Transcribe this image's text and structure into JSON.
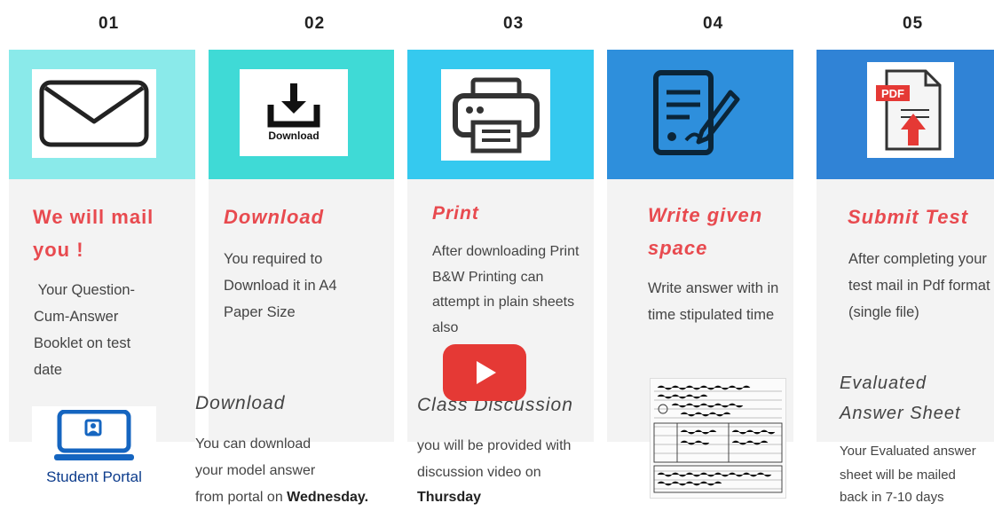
{
  "steps": [
    {
      "number": "01",
      "title": "We will mail you !",
      "body": " Your Question-Cum-Answer Booklet on test date",
      "icon": "envelope-icon"
    },
    {
      "number": "02",
      "title": "Download",
      "body": "You required to Download it in A4 Paper Size",
      "icon": "download-icon",
      "icon_label": "Download"
    },
    {
      "number": "03",
      "title": "Print",
      "body": "After downloading Print B&W Printing can attempt in plain sheets also",
      "icon": "printer-icon"
    },
    {
      "number": "04",
      "title": "Write given space",
      "body": "Write answer with in time stipulated time",
      "icon": "document-pen-icon"
    },
    {
      "number": "05",
      "title": "Submit Test",
      "body": "After completing your test mail in Pdf format (single file)",
      "icon": "pdf-upload-icon",
      "icon_label": "PDF"
    }
  ],
  "student_portal": {
    "label": "Student Portal",
    "icon": "student-portal-icon"
  },
  "download_section": {
    "title": "Download",
    "line1": "You can download",
    "line2": "your model answer",
    "line3_prefix": "from portal on ",
    "line3_bold": "Wednesday."
  },
  "class_discussion": {
    "title": "Class Discussion",
    "line1": "you will be provided with",
    "line2": "discussion video on",
    "line3_bold": "Thursday",
    "play_icon": "youtube-play-icon"
  },
  "evaluated": {
    "title_line1": "Evaluated",
    "title_line2": "Answer Sheet",
    "line1": "Your Evaluated answer",
    "line2": "sheet will be mailed",
    "line3": "back in 7-10 days"
  },
  "colors": {
    "accent": "#e84a4f",
    "band1": "#8aeaea",
    "band2": "#3fdad6",
    "band3": "#35c9ef",
    "band4": "#2e8fdc",
    "band5": "#3083d6"
  }
}
